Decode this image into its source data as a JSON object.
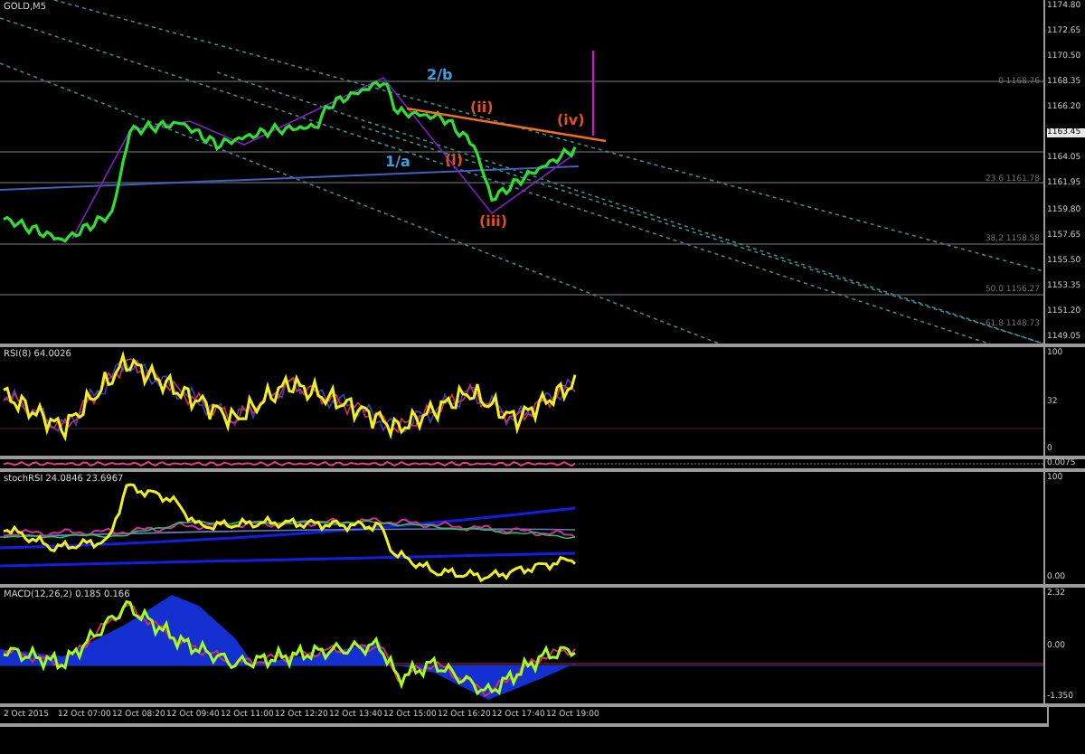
{
  "chart": {
    "symbol": "GOLD,M5",
    "price_axis": [
      "1174.80",
      "1172.65",
      "1170.50",
      "1168.35",
      "1166.20",
      "1164.05",
      "1161.95",
      "1159.80",
      "1157.65",
      "1155.50",
      "1153.35",
      "1151.20",
      "1149.05"
    ],
    "current_price": "1163.45",
    "fib_levels": [
      {
        "label": "0 1168.76"
      },
      {
        "label": "23.6 1161.78"
      },
      {
        "label": "38.2 1158.58"
      },
      {
        "label": "50.0 1156.27"
      },
      {
        "label": "61.8 1148.73"
      }
    ],
    "wave_labels": [
      {
        "text": "2/b",
        "color": "#3aa0e0"
      },
      {
        "text": "(ii)",
        "color": "#e05020"
      },
      {
        "text": "(iv)",
        "color": "#e05020"
      },
      {
        "text": "1/a",
        "color": "#3aa0e0"
      },
      {
        "text": "(i)",
        "color": "#e05020"
      },
      {
        "text": "(iii)",
        "color": "#e05020"
      }
    ]
  },
  "indicators": [
    {
      "kind": "rsi",
      "label": "RSI(8) 64.0026",
      "axis": [
        "100",
        "32",
        "0"
      ]
    },
    {
      "kind": "band",
      "axis": [
        "0.0075"
      ]
    },
    {
      "kind": "stoch",
      "label": "stochRSI 24.0846 23.6967",
      "axis": [
        "100",
        "0.00"
      ]
    },
    {
      "kind": "macd",
      "label": "MACD(12,26,2) 0.185 0.166",
      "axis": [
        "2.32",
        "0.00",
        "-1.350"
      ]
    }
  ],
  "time_axis": [
    "2 Oct 2015",
    "12 Oct 07:00",
    "12 Oct 08:20",
    "12 Oct 09:40",
    "12 Oct 11:00",
    "12 Oct 12:20",
    "12 Oct 13:40",
    "12 Oct 15:00",
    "12 Oct 16:20",
    "12 Oct 17:40",
    "12 Oct 19:00"
  ]
}
